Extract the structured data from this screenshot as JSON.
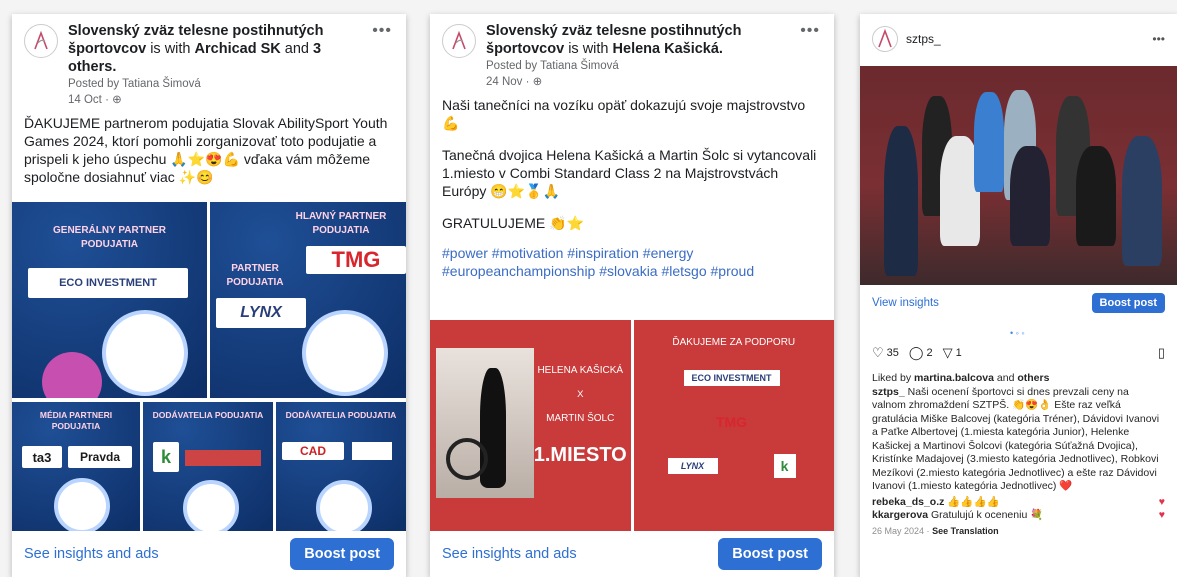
{
  "post1": {
    "page_name": "Slovenský zväz telesne postihnutých športovcov",
    "with_text": "is with",
    "tagged": "Archicad SK",
    "and_text": "and",
    "others": "3 others.",
    "posted_by": "Posted by Tatiana Šimová",
    "date": "14 Oct · ⊕",
    "body": "ĎAKUJEME partnerom podujatia Slovak AbilitySport Youth Games 2024, ktorí pomohli zorganizovať toto podujatie a prispeli k jeho úspechu 🙏⭐😍💪 vďaka vám môžeme spoločne dosiahnuť viac ✨😊",
    "tiles": {
      "general": "GENERÁLNY PARTNER PODUJATIA",
      "eco": "ECO INVESTMENT",
      "hlavny": "HLAVNÝ PARTNER PODUJATIA",
      "tmg": "TMG",
      "partner": "PARTNER PODUJATIA",
      "lynx": "LYNX",
      "media": "MÉDIA PARTNERI PODUJATIA",
      "ta3": "ta3",
      "pravda": "Pravda",
      "dodav1": "DODÁVATELIA PODUJATIA",
      "dodav2": "DODÁVATELIA PODUJATIA",
      "cad": "CAD"
    },
    "insights": "See insights and ads",
    "boost": "Boost post"
  },
  "post2": {
    "page_name": "Slovenský zväz telesne postihnutých športovcov",
    "with_text": "is with",
    "tagged": "Helena Kašická.",
    "posted_by": "Posted by Tatiana Šimová",
    "date": "24 Nov · ⊕",
    "body1": "Naši tanečníci na vozíku opäť dokazujú svoje majstrovstvo💪",
    "body2": "Tanečná dvojica Helena Kašická a Martin Šolc si vytancovali 1.miesto v Combi Standard Class 2 na Majstrovstvách Európy 😁⭐🥇🙏",
    "body3": "GRATULUJEME 👏⭐",
    "tags": "#power #motivation #inspiration #energy #europeanchampionship #slovakia #letsgo #proud",
    "img_left": {
      "names1": "HELENA KAŠICKÁ",
      "x": "X",
      "names2": "MARTIN ŠOLC",
      "place": "1.MIESTO"
    },
    "img_right": {
      "title": "ĎAKUJEME ZA PODPORU",
      "eco": "ECO INVESTMENT",
      "tmg": "TMG",
      "lynx": "LYNX",
      "k": "k"
    },
    "insights": "See insights and ads",
    "boost": "Boost post"
  },
  "post3": {
    "username": "sztps_",
    "view_insights": "View insights",
    "boost": "Boost post",
    "likes_count": "35",
    "comments_count": "2",
    "shares_count": "1",
    "liked_by_prefix": "Liked by",
    "liked_by_user": "martina.balcova",
    "liked_by_and": "and",
    "liked_by_others": "others",
    "caption_user": "sztps_",
    "caption": "Naši ocenení športovci si dnes prevzali ceny na valnom zhromaždení SZTPŠ. 👏😍👌 Ešte raz veľká gratulácia Miške Balcovej (kategória Tréner), Dávidovi Ivanovi a Paťke Albertovej (1.miesta kategória Junior), Helenke Kašickej a Martinovi Šolcovi (kategória Súťažná Dvojica), Kristínke Madajovej (3.miesto kategória Jednotlivec), Robkovi Mezíkovi (2.miesto kategória Jednotlivec) a ešte raz Dávidovi Ivanovi (1.miesto kategória Jednotlivec) ❤️",
    "comment1_user": "rebeka_ds_o.z",
    "comment1_text": "👍👍👍👍",
    "comment2_user": "kkargerova",
    "comment2_text": "Gratulujú k oceneniu 💐",
    "date": "26 May 2024 ·",
    "see_translation": "See Translation"
  },
  "colors": {
    "facebook_blue": "#2d6fd3",
    "red_panel": "#c93a3a",
    "navy_tile": "#0d2e66"
  }
}
